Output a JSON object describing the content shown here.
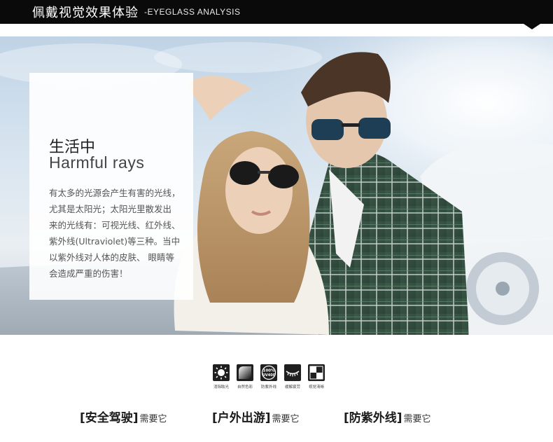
{
  "header": {
    "title": "佩戴视觉效果体验",
    "subtitle": "-EYEGLASS ANALYSIS"
  },
  "card": {
    "title_cn": "生活中",
    "title_en": "Harmful rays",
    "body_lines": [
      "有太多的光源会产生有害的光线，",
      "尤其是太阳光；太阳光里散发出",
      "来的光线有：可视光线、红外线、",
      "紫外线(Ultraviolet)等三种。当中",
      "以紫外线对人体的皮肤、 眼睛等",
      "会造成严重的伤害！"
    ]
  },
  "features": [
    {
      "icon": "sun-glare-icon",
      "label": "消除眩光"
    },
    {
      "icon": "natural-color-icon",
      "label": "自然色彩"
    },
    {
      "icon": "uv400-icon",
      "label": "防紫外线",
      "badge_top": "100%",
      "badge_bottom": "UV400"
    },
    {
      "icon": "eye-lash-icon",
      "label": "缓解疲劳"
    },
    {
      "icon": "clarity-icon",
      "label": "视觉清晰"
    }
  ],
  "scenarios": [
    {
      "title": "[安全驾驶]",
      "suffix": "需要它"
    },
    {
      "title": "[户外出游]",
      "suffix": "需要它"
    },
    {
      "title": "[防紫外线]",
      "suffix": "需要它"
    }
  ]
}
